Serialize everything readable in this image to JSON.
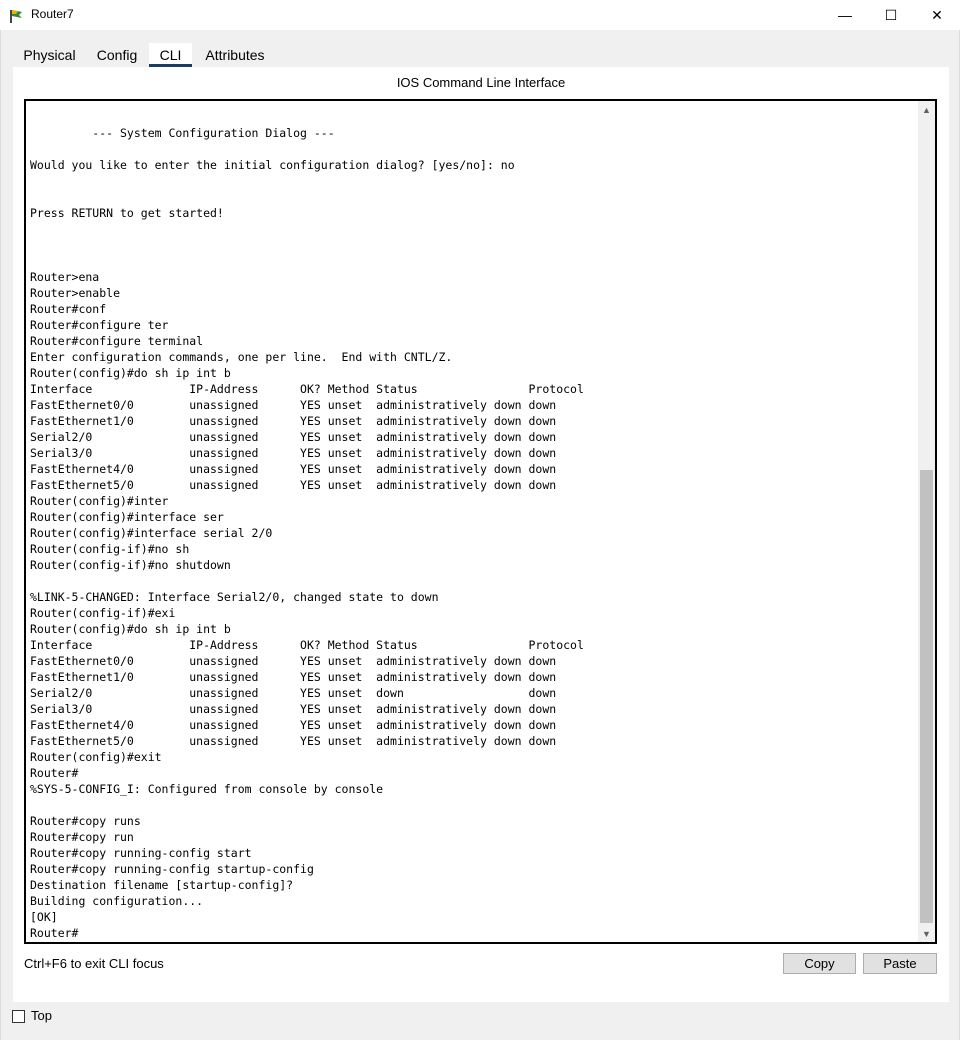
{
  "window": {
    "title": "Router7",
    "minimize_glyph": "—",
    "maximize_glyph": "☐",
    "close_glyph": "✕"
  },
  "tabs": [
    {
      "label": "Physical",
      "active": false
    },
    {
      "label": "Config",
      "active": false
    },
    {
      "label": "CLI",
      "active": true
    },
    {
      "label": "Attributes",
      "active": false
    }
  ],
  "panel": {
    "title": "IOS Command Line Interface"
  },
  "terminal": {
    "lines": [
      "",
      "         --- System Configuration Dialog ---",
      "",
      "Would you like to enter the initial configuration dialog? [yes/no]: no",
      "",
      "",
      "Press RETURN to get started!",
      "",
      "",
      "",
      "Router>ena",
      "Router>enable",
      "Router#conf",
      "Router#configure ter",
      "Router#configure terminal",
      "Enter configuration commands, one per line.  End with CNTL/Z.",
      "Router(config)#do sh ip int b",
      "Interface              IP-Address      OK? Method Status                Protocol",
      "FastEthernet0/0        unassigned      YES unset  administratively down down",
      "FastEthernet1/0        unassigned      YES unset  administratively down down",
      "Serial2/0              unassigned      YES unset  administratively down down",
      "Serial3/0              unassigned      YES unset  administratively down down",
      "FastEthernet4/0        unassigned      YES unset  administratively down down",
      "FastEthernet5/0        unassigned      YES unset  administratively down down",
      "Router(config)#inter",
      "Router(config)#interface ser",
      "Router(config)#interface serial 2/0",
      "Router(config-if)#no sh",
      "Router(config-if)#no shutdown",
      "",
      "%LINK-5-CHANGED: Interface Serial2/0, changed state to down",
      "Router(config-if)#exi",
      "Router(config)#do sh ip int b",
      "Interface              IP-Address      OK? Method Status                Protocol",
      "FastEthernet0/0        unassigned      YES unset  administratively down down",
      "FastEthernet1/0        unassigned      YES unset  administratively down down",
      "Serial2/0              unassigned      YES unset  down                  down",
      "Serial3/0              unassigned      YES unset  administratively down down",
      "FastEthernet4/0        unassigned      YES unset  administratively down down",
      "FastEthernet5/0        unassigned      YES unset  administratively down down",
      "Router(config)#exit",
      "Router#",
      "%SYS-5-CONFIG_I: Configured from console by console",
      "",
      "Router#copy runs",
      "Router#copy run",
      "Router#copy running-config start",
      "Router#copy running-config startup-config",
      "Destination filename [startup-config]?",
      "Building configuration...",
      "[OK]",
      "Router#"
    ]
  },
  "footer": {
    "hint": "Ctrl+F6 to exit CLI focus",
    "copy_label": "Copy",
    "paste_label": "Paste"
  },
  "bottom": {
    "top_label": "Top",
    "top_checked": false
  },
  "colors": {
    "active_tab_underline": "#1a3d66",
    "client_background": "#f0f0f0"
  }
}
